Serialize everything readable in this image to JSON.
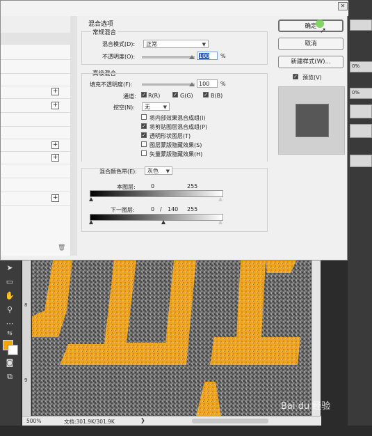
{
  "dialog": {
    "title": "混合选项",
    "normal_group": {
      "title": "常规混合",
      "blend_mode_label": "混合模式(D):",
      "blend_mode_value": "正常",
      "opacity_label": "不透明度(O):",
      "opacity_value": "100",
      "opacity_unit": "%"
    },
    "advanced_group": {
      "title": "高级混合",
      "fill_opacity_label": "填充不透明度(F):",
      "fill_opacity_value": "100",
      "fill_opacity_unit": "%",
      "channels_label": "通道:",
      "channel_r": "R(R)",
      "channel_g": "G(G)",
      "channel_b": "B(B)",
      "knockout_label": "挖空(N):",
      "knockout_value": "无",
      "options": [
        {
          "label": "将内部效果混合成组(I)",
          "checked": false
        },
        {
          "label": "将剪贴图层混合成组(P)",
          "checked": true
        },
        {
          "label": "透明形状图层(T)",
          "checked": true
        },
        {
          "label": "图层蒙版隐藏效果(S)",
          "checked": false
        },
        {
          "label": "矢量蒙版隐藏效果(H)",
          "checked": false
        }
      ]
    },
    "blend_if": {
      "label": "混合颜色带(E):",
      "value": "灰色",
      "this_layer_label": "本图层:",
      "this_layer_min": "0",
      "this_layer_max": "255",
      "underlying_label": "下一图层:",
      "underlying_min": "0",
      "underlying_sep": "/",
      "underlying_mid": "140",
      "underlying_max": "255"
    },
    "buttons": {
      "ok": "确定",
      "cancel": "取消",
      "new_style": "新建样式(W)...",
      "preview_label": "预览(V)",
      "preview_checked": true
    }
  },
  "right_panel": {
    "percent_1": "0%",
    "percent_2": "0%"
  },
  "status": {
    "zoom": "500%",
    "doc_info": "文档:301.9K/301.9K"
  },
  "ruler": {
    "mark_8": "8",
    "mark_9": "9"
  },
  "watermark": "Bai du 经验"
}
